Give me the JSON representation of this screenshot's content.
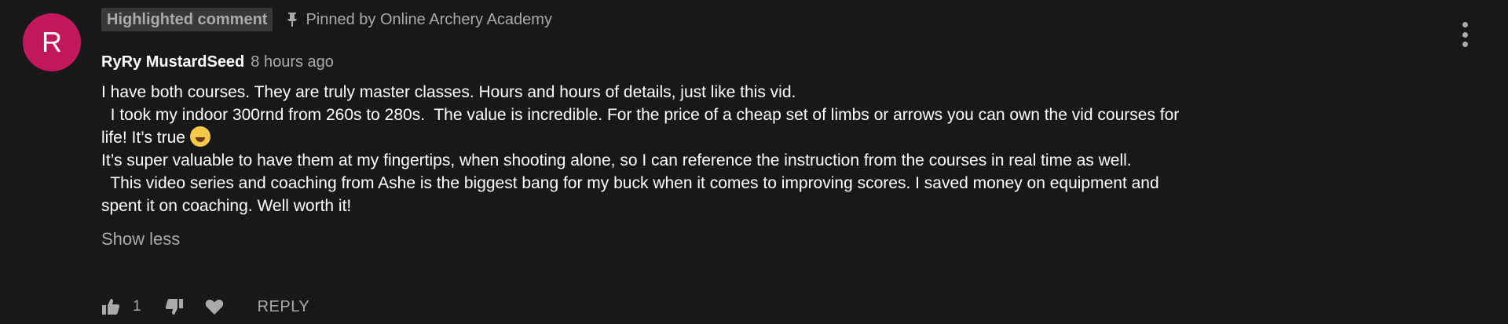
{
  "comment": {
    "avatar_letter": "R",
    "avatar_color": "#c2185b",
    "highlight_badge": "Highlighted comment",
    "pinned_text": "Pinned by Online Archery Academy",
    "author": "RyRy MustardSeed",
    "timestamp": "8 hours ago",
    "lines": [
      "I have both courses. They are truly master classes. Hours and hours of details, just like this vid.",
      "  I took my indoor 300rnd from 260s to 280s.  The value is incredible. For the price of a cheap set of limbs or arrows you can own the vid courses for",
      "life! It’s true",
      "It’s super valuable to have them at my fingertips, when shooting alone, so I can reference the instruction from the courses in real time as well.",
      "  This video series and coaching from Ashe is the biggest bang for my buck when it comes to improving scores. I saved money on equipment and",
      "spent it on coaching. Well worth it!"
    ],
    "emoji_icon": "laughing-emoji-icon",
    "show_less_label": "Show less",
    "like_count": "1",
    "reply_label": "REPLY"
  },
  "colors": {
    "background": "#181818",
    "primary_text": "#ffffff",
    "secondary_text": "#aaaaaa",
    "badge_bg": "#383838"
  }
}
